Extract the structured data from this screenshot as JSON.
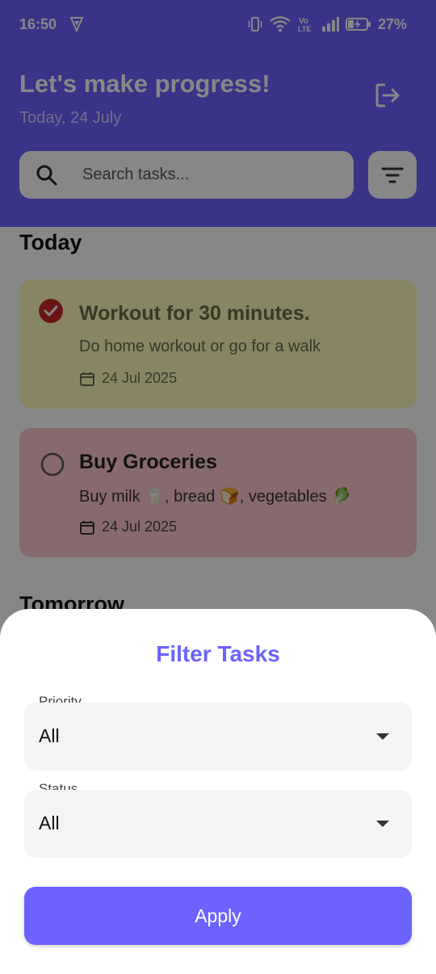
{
  "status_bar": {
    "time": "16:50",
    "vo_label": "Vo",
    "lte_label": "LTE",
    "battery": "27%"
  },
  "header": {
    "title": "Let's make progress!",
    "date": "Today, 24 July"
  },
  "search": {
    "placeholder": "Search tasks..."
  },
  "sections": {
    "today": "Today",
    "tomorrow": "Tomorrow"
  },
  "tasks": [
    {
      "title": "Workout for 30 minutes.",
      "description": "Do home workout or go for a walk",
      "date": "24 Jul 2025",
      "completed": true,
      "color": "#fffcbd"
    },
    {
      "title": "Buy Groceries",
      "description": "Buy milk 🥛, bread 🍞, vegetables 🥬",
      "date": "24 Jul 2025",
      "completed": false,
      "color": "#ffc9cf"
    }
  ],
  "filter_sheet": {
    "title": "Filter Tasks",
    "priority_label": "Priority",
    "priority_value": "All",
    "status_label": "Status",
    "status_value": "All",
    "apply_label": "Apply"
  },
  "colors": {
    "accent": "#6c63ff",
    "check": "#c62828"
  }
}
